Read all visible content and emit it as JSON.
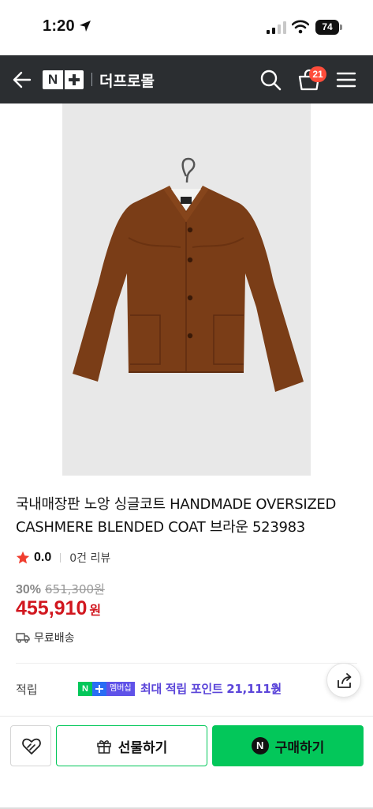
{
  "status_bar": {
    "time": "1:20",
    "battery": "74",
    "icons": [
      "location-arrow-icon",
      "signal-icon",
      "wifi-icon",
      "battery-icon"
    ]
  },
  "header": {
    "logo": "N+",
    "mall_name": "더프로몰",
    "cart_count": "21",
    "background": "#2b2e31",
    "icons": [
      "back-arrow-icon",
      "search-icon",
      "cart-icon",
      "menu-icon"
    ]
  },
  "product": {
    "image_alt": "brown jacket on hanger",
    "title": "국내매장판 노앙 싱글코트 HANDMADE OVERSIZED CASHMERE BLENDED COAT 브라운 523983",
    "rating": "0.0",
    "review_count": "0건 리뷰",
    "discount_rate": "30%",
    "original_price": "651,300원",
    "sale_price": "455,910",
    "sale_unit": "원",
    "shipping": "무료배송",
    "price_color": "#d1171f"
  },
  "points": {
    "label": "적립",
    "badge_n": "N",
    "badge_text": "멤버십",
    "text": "최대 적립 포인트 21,111원",
    "color": "#5b45d9"
  },
  "actions": {
    "gift_label": "선물하기",
    "buy_label": "구매하기",
    "buy_icon_letter": "N",
    "accent": "#03c75a",
    "icons": [
      "wishlist-heart-icon",
      "gift-icon",
      "share-icon"
    ]
  }
}
